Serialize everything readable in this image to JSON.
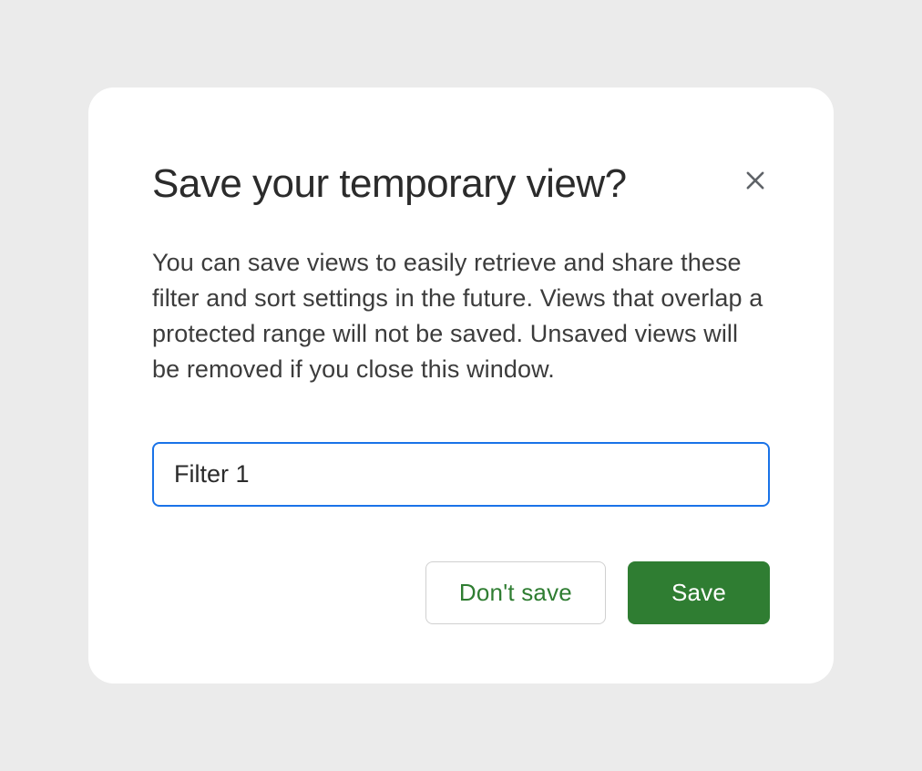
{
  "dialog": {
    "title": "Save your temporary view?",
    "body": "You can save views to easily retrieve and share these filter and sort settings in the future. Views that overlap a protected range will not be saved. Unsaved views will be removed if you close this window.",
    "input_value": "Filter 1",
    "actions": {
      "dont_save": "Don't save",
      "save": "Save"
    }
  }
}
